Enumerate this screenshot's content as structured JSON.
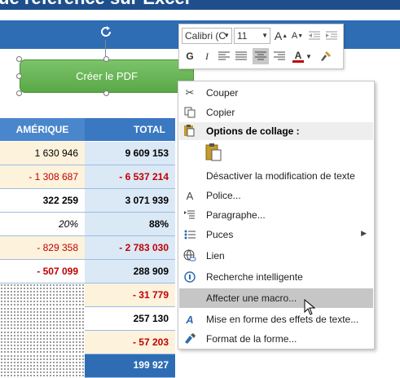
{
  "banner": {
    "title": "ue référence sur Excel"
  },
  "table": {
    "headers": {
      "col1": "AMÉRIQUE",
      "col2": "TOTAL"
    },
    "rows": [
      {
        "a": "1 630 946",
        "t": "9 609 153"
      },
      {
        "a": "- 1 308 687",
        "t": "- 6 537 214"
      },
      {
        "a": "322 259",
        "t": "3 071 939"
      },
      {
        "a": "20%",
        "t": "88%"
      },
      {
        "a": "- 829 358",
        "t": "- 2 783 030"
      },
      {
        "a": "- 507 099",
        "t": "288 909"
      },
      {
        "a": "",
        "t": "- 31 779"
      },
      {
        "a": "",
        "t": "257 130"
      },
      {
        "a": "",
        "t": "- 57 203"
      },
      {
        "a": "",
        "t": "199 927"
      }
    ]
  },
  "shape": {
    "label": "Créer le PDF"
  },
  "mini_toolbar": {
    "font": "Calibri (C",
    "size": "11",
    "grow": "A",
    "shrink": "A",
    "bold": "G",
    "italic": "I",
    "underline_color_letter": "A"
  },
  "menu": {
    "cut": "Couper",
    "copy": "Copier",
    "paste_options": "Options de collage :",
    "disable_text_edit": "Désactiver la modification de texte",
    "font": "Police...",
    "paragraph": "Paragraphe...",
    "bullets": "Puces",
    "link": "Lien",
    "smart_lookup": "Recherche intelligente",
    "assign_macro": "Affecter une macro...",
    "format_effects": "Mise en forme des effets de texte...",
    "format_shape": "Format de la forme..."
  },
  "colors": {
    "banner": "#1e4f8c",
    "header": "#3a78c2",
    "negative": "#c00000",
    "shape_green": "#6bb558",
    "highlight": "#c6c6c6"
  }
}
